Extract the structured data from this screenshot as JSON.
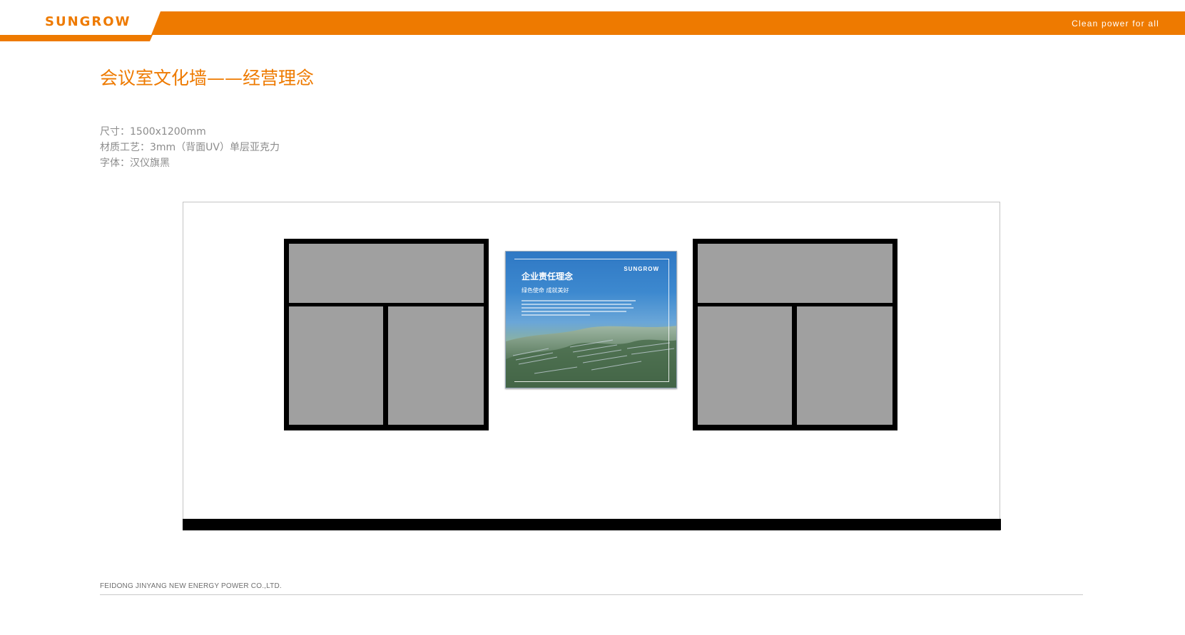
{
  "header": {
    "brand": "SUNGROW",
    "tagline": "Clean  power  for  all",
    "accent_color": "#ee7a00"
  },
  "page": {
    "title": "会议室文化墙——经营理念"
  },
  "specs": {
    "size": "尺寸：1500x1200mm",
    "material": "材质工艺：3mm（背面UV）单层亚克力",
    "font": "字体：汉仪旗黑"
  },
  "poster": {
    "logo": "SUNGROW",
    "title": "企业责任理念",
    "subtitle": "绿色使命  成就美好"
  },
  "footer": {
    "company": "FEIDONG JINYANG NEW ENERGY POWER CO.,LTD."
  }
}
